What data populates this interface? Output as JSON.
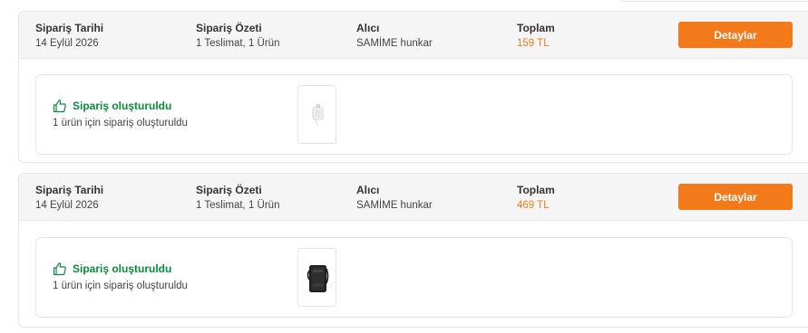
{
  "orders": [
    {
      "date_label": "Sipariş Tarihi",
      "date_value": "14 Eylül 2026",
      "summary_label": "Sipariş Özeti",
      "summary_value": "1 Teslimat, 1 Ürün",
      "recipient_label": "Alıcı",
      "recipient_value": "SAMİME hunkar",
      "total_label": "Toplam",
      "total_value": "159 TL",
      "details_label": "Detaylar",
      "status_title": "Sipariş oluşturuldu",
      "status_desc": "1 ürün için sipariş oluşturuldu",
      "product_icon": "charger-adapter-image"
    },
    {
      "date_label": "Sipariş Tarihi",
      "date_value": "14 Eylül 2026",
      "summary_label": "Sipariş Özeti",
      "summary_value": "1 Teslimat, 1 Ürün",
      "recipient_label": "Alıcı",
      "recipient_value": "SAMİME hunkar",
      "total_label": "Toplam",
      "total_value": "469 TL",
      "details_label": "Detaylar",
      "status_title": "Sipariş oluşturuldu",
      "status_desc": "1 ürün için sipariş oluşturuldu",
      "product_icon": "power-bank-image"
    }
  ],
  "colors": {
    "accent_orange": "#f27a1a",
    "success_green": "#0b8a3e",
    "header_bg": "#f5f5f5",
    "border": "#e6e6e6"
  }
}
